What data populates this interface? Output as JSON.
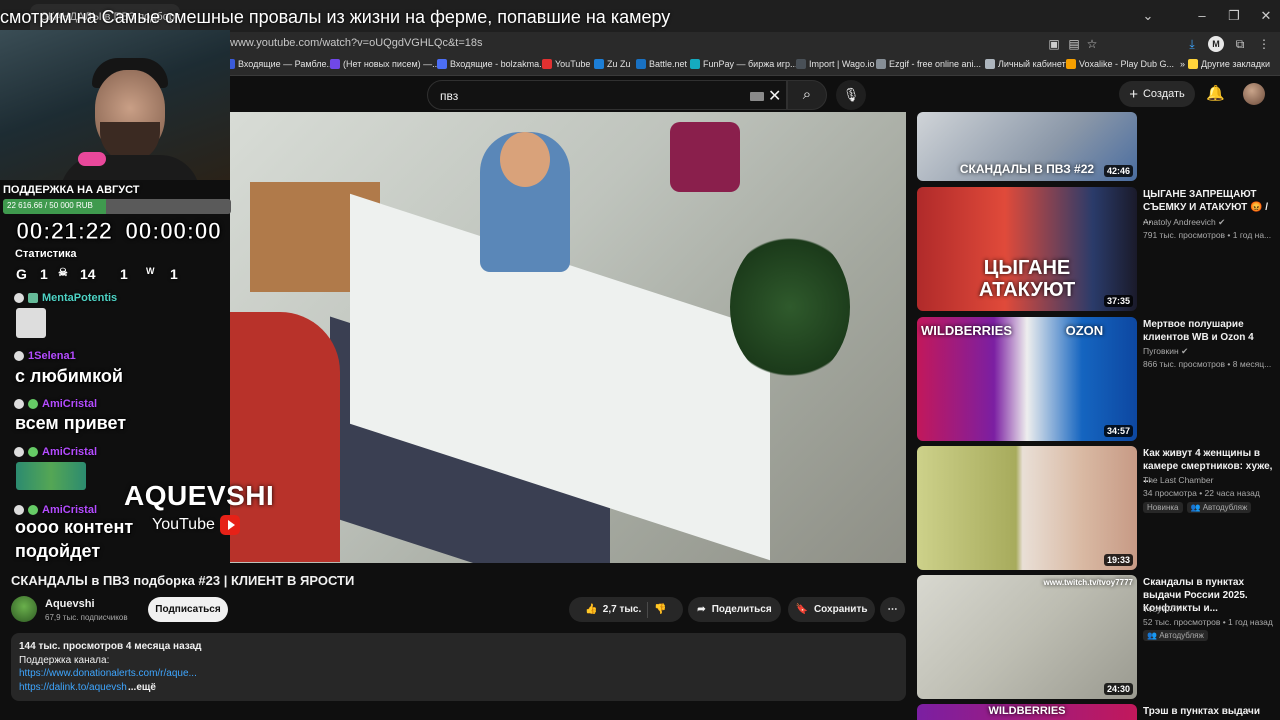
{
  "browser": {
    "tab_title": "СКАНДАЛЫ в ПВЗ подборка",
    "url": "www.youtube.com/watch?v=oUQgdVGHLQc&t=18s",
    "bookmarks": [
      "Входящие — Рамбле...",
      "(Нет новых писем) —...",
      "Входящие - bolzakma...",
      "YouTube",
      "Zu Zu",
      "Battle.net",
      "FunPay — биржа игр...",
      "Import | Wago.io",
      "Ezgif - free online ani...",
      "Личный кабинет",
      "Voxalike - Play Dub G...",
      "Другие закладки"
    ]
  },
  "overlay": {
    "title": "смотрим на Самые смешные провалы из жизни на ферме, попавшие на камеру",
    "donation_label": "ПОДДЕРЖКА НА АВГУСТ",
    "donation_text": "22 616.66 / 50 000 RUB",
    "donation_progress": 0.45,
    "timer_left": "00:21:22",
    "timer_right": "00:00:00",
    "stats_label": "Статистика",
    "stats": [
      "1",
      "14",
      "1",
      "1"
    ],
    "chat": [
      {
        "name": "MentaPotentis",
        "msg": ""
      },
      {
        "name": "1Selena1",
        "msg": "с любимкой"
      },
      {
        "name": "AmiCristal",
        "msg": "всем привет"
      },
      {
        "name": "AmiCristal",
        "msg": ""
      },
      {
        "name": "AmiCristal",
        "msg": "оооо контент"
      },
      {
        "name": "",
        "msg": "подойдет"
      }
    ],
    "logo_text": "AQUEVSHI",
    "logo_platform": "YouTube"
  },
  "header": {
    "search_value": "пвз",
    "create_label": "Создать"
  },
  "video": {
    "title": "СКАНДАЛЫ в ПВЗ подборка #23 | КЛИЕНТ В ЯРОСТИ",
    "channel": "Aquevshi",
    "subscribers": "67,9 тыс. подписчиков",
    "subscribe_label": "Подписаться",
    "likes": "2,7 тыс.",
    "share_label": "Поделиться",
    "save_label": "Сохранить",
    "description": {
      "meta": "144 тыс. просмотров  4 месяца назад",
      "support": "Поддержка канала:",
      "link1": "https://www.donationalerts.com/r/aque...",
      "link2": "https://dalink.to/aquevsh",
      "more": "...ещё"
    }
  },
  "recommendations": [
    {
      "title": "",
      "channel": "",
      "stats": "",
      "duration": "42:46",
      "thumb_text": "СКАНДАЛЫ В ПВЗ #22"
    },
    {
      "title": "ЦЫГАНЕ ЗАПРЕЩАЮТ СЪЕМКУ И АТАКУЮТ 😡 / ...",
      "channel": "Anatoly Andreevich",
      "stats": "791 тыс. просмотров • 1 год на...",
      "duration": "37:35",
      "thumb_text": "ЦЫГАНЕ АТАКУЮТ"
    },
    {
      "title": "Мертвое полушарие клиентов WB и Ozon 4",
      "channel": "Пуговкин",
      "stats": "866 тыс. просмотров • 8 месяц...",
      "duration": "34:57",
      "thumb_text": "WILDBERRIES OZON"
    },
    {
      "title": "Как живут 4 женщины в камере смертников: хуже, ...",
      "channel": "The Last Chamber",
      "stats": "34 просмотра • 22 часа назад",
      "badges": [
        "Новинка",
        "Автодубляж"
      ],
      "duration": "19:33",
      "thumb_text": ""
    },
    {
      "title": "Скандалы в пунктах выдачи России 2025. Конфликты и...",
      "channel": "Tvoy7777",
      "stats": "52 тыс. просмотров • 1 год назад",
      "badges": [
        "Автодубляж"
      ],
      "duration": "24:30",
      "thumb_text": "www.twitch.tv/tvoy7777"
    },
    {
      "title": "Трэш в пунктах выдачи",
      "channel": "",
      "stats": "",
      "duration": "",
      "thumb_text": "WILDBERRIES"
    }
  ]
}
